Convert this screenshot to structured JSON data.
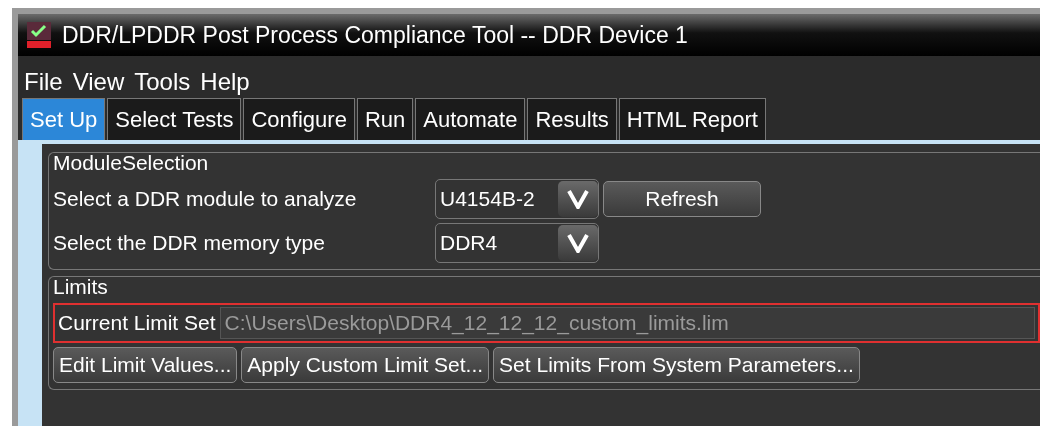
{
  "window": {
    "title": "DDR/LPDDR Post Process Compliance Tool -- DDR Device 1"
  },
  "menu": [
    "File",
    "View",
    "Tools",
    "Help"
  ],
  "tabs": [
    {
      "label": "Set Up",
      "selected": true
    },
    {
      "label": "Select Tests",
      "selected": false
    },
    {
      "label": "Configure",
      "selected": false
    },
    {
      "label": "Run",
      "selected": false
    },
    {
      "label": "Automate",
      "selected": false
    },
    {
      "label": "Results",
      "selected": false
    },
    {
      "label": "HTML Report",
      "selected": false
    }
  ],
  "module_selection": {
    "title": "ModuleSelection",
    "rows": [
      {
        "label": "Select a DDR module to analyze",
        "value": "U4154B-2",
        "button": "Refresh"
      },
      {
        "label": "Select the DDR memory type",
        "value": "DDR4"
      }
    ]
  },
  "limits": {
    "title": "Limits",
    "current_label": "Current Limit Set",
    "current_value": "C:\\Users\\Desktop\\DDR4_12_12_12_custom_limits.lim",
    "highlighted": true,
    "buttons": [
      "Edit Limit Values...",
      "Apply Custom Limit Set...",
      "Set Limits From System Parameters..."
    ]
  }
}
